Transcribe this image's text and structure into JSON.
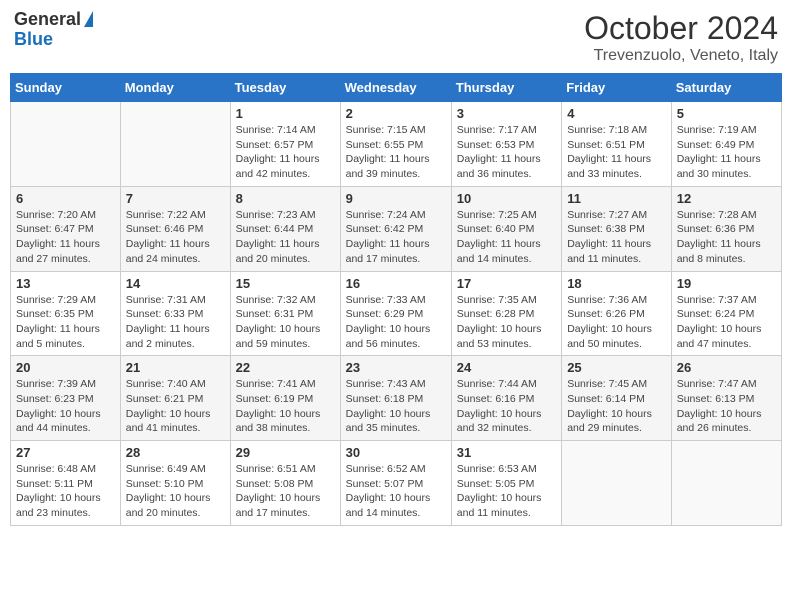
{
  "logo": {
    "general": "General",
    "blue": "Blue"
  },
  "title": "October 2024",
  "location": "Trevenzuolo, Veneto, Italy",
  "days_of_week": [
    "Sunday",
    "Monday",
    "Tuesday",
    "Wednesday",
    "Thursday",
    "Friday",
    "Saturday"
  ],
  "weeks": [
    [
      {
        "day": "",
        "info": ""
      },
      {
        "day": "",
        "info": ""
      },
      {
        "day": "1",
        "info": "Sunrise: 7:14 AM\nSunset: 6:57 PM\nDaylight: 11 hours and 42 minutes."
      },
      {
        "day": "2",
        "info": "Sunrise: 7:15 AM\nSunset: 6:55 PM\nDaylight: 11 hours and 39 minutes."
      },
      {
        "day": "3",
        "info": "Sunrise: 7:17 AM\nSunset: 6:53 PM\nDaylight: 11 hours and 36 minutes."
      },
      {
        "day": "4",
        "info": "Sunrise: 7:18 AM\nSunset: 6:51 PM\nDaylight: 11 hours and 33 minutes."
      },
      {
        "day": "5",
        "info": "Sunrise: 7:19 AM\nSunset: 6:49 PM\nDaylight: 11 hours and 30 minutes."
      }
    ],
    [
      {
        "day": "6",
        "info": "Sunrise: 7:20 AM\nSunset: 6:47 PM\nDaylight: 11 hours and 27 minutes."
      },
      {
        "day": "7",
        "info": "Sunrise: 7:22 AM\nSunset: 6:46 PM\nDaylight: 11 hours and 24 minutes."
      },
      {
        "day": "8",
        "info": "Sunrise: 7:23 AM\nSunset: 6:44 PM\nDaylight: 11 hours and 20 minutes."
      },
      {
        "day": "9",
        "info": "Sunrise: 7:24 AM\nSunset: 6:42 PM\nDaylight: 11 hours and 17 minutes."
      },
      {
        "day": "10",
        "info": "Sunrise: 7:25 AM\nSunset: 6:40 PM\nDaylight: 11 hours and 14 minutes."
      },
      {
        "day": "11",
        "info": "Sunrise: 7:27 AM\nSunset: 6:38 PM\nDaylight: 11 hours and 11 minutes."
      },
      {
        "day": "12",
        "info": "Sunrise: 7:28 AM\nSunset: 6:36 PM\nDaylight: 11 hours and 8 minutes."
      }
    ],
    [
      {
        "day": "13",
        "info": "Sunrise: 7:29 AM\nSunset: 6:35 PM\nDaylight: 11 hours and 5 minutes."
      },
      {
        "day": "14",
        "info": "Sunrise: 7:31 AM\nSunset: 6:33 PM\nDaylight: 11 hours and 2 minutes."
      },
      {
        "day": "15",
        "info": "Sunrise: 7:32 AM\nSunset: 6:31 PM\nDaylight: 10 hours and 59 minutes."
      },
      {
        "day": "16",
        "info": "Sunrise: 7:33 AM\nSunset: 6:29 PM\nDaylight: 10 hours and 56 minutes."
      },
      {
        "day": "17",
        "info": "Sunrise: 7:35 AM\nSunset: 6:28 PM\nDaylight: 10 hours and 53 minutes."
      },
      {
        "day": "18",
        "info": "Sunrise: 7:36 AM\nSunset: 6:26 PM\nDaylight: 10 hours and 50 minutes."
      },
      {
        "day": "19",
        "info": "Sunrise: 7:37 AM\nSunset: 6:24 PM\nDaylight: 10 hours and 47 minutes."
      }
    ],
    [
      {
        "day": "20",
        "info": "Sunrise: 7:39 AM\nSunset: 6:23 PM\nDaylight: 10 hours and 44 minutes."
      },
      {
        "day": "21",
        "info": "Sunrise: 7:40 AM\nSunset: 6:21 PM\nDaylight: 10 hours and 41 minutes."
      },
      {
        "day": "22",
        "info": "Sunrise: 7:41 AM\nSunset: 6:19 PM\nDaylight: 10 hours and 38 minutes."
      },
      {
        "day": "23",
        "info": "Sunrise: 7:43 AM\nSunset: 6:18 PM\nDaylight: 10 hours and 35 minutes."
      },
      {
        "day": "24",
        "info": "Sunrise: 7:44 AM\nSunset: 6:16 PM\nDaylight: 10 hours and 32 minutes."
      },
      {
        "day": "25",
        "info": "Sunrise: 7:45 AM\nSunset: 6:14 PM\nDaylight: 10 hours and 29 minutes."
      },
      {
        "day": "26",
        "info": "Sunrise: 7:47 AM\nSunset: 6:13 PM\nDaylight: 10 hours and 26 minutes."
      }
    ],
    [
      {
        "day": "27",
        "info": "Sunrise: 6:48 AM\nSunset: 5:11 PM\nDaylight: 10 hours and 23 minutes."
      },
      {
        "day": "28",
        "info": "Sunrise: 6:49 AM\nSunset: 5:10 PM\nDaylight: 10 hours and 20 minutes."
      },
      {
        "day": "29",
        "info": "Sunrise: 6:51 AM\nSunset: 5:08 PM\nDaylight: 10 hours and 17 minutes."
      },
      {
        "day": "30",
        "info": "Sunrise: 6:52 AM\nSunset: 5:07 PM\nDaylight: 10 hours and 14 minutes."
      },
      {
        "day": "31",
        "info": "Sunrise: 6:53 AM\nSunset: 5:05 PM\nDaylight: 10 hours and 11 minutes."
      },
      {
        "day": "",
        "info": ""
      },
      {
        "day": "",
        "info": ""
      }
    ]
  ]
}
